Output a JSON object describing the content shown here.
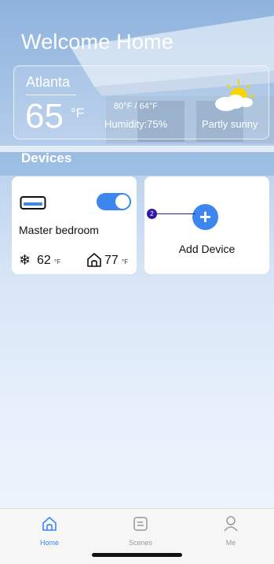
{
  "header": {
    "title": "Welcome Home"
  },
  "weather": {
    "city": "Atlanta",
    "temperature": "65",
    "unit": "°F",
    "high_low": "80°F / 64°F",
    "humidity": "Humidity:75%",
    "condition": "Partly sunny",
    "icon": "partly-sunny-icon"
  },
  "devices": {
    "section_title": "Devices",
    "items": [
      {
        "room": "Master bedroom",
        "icon": "air-conditioner-icon",
        "power_on": true,
        "set_temp": "62",
        "set_unit": "°F",
        "current_temp": "77",
        "current_unit": "°F"
      }
    ],
    "add_label": "Add Device"
  },
  "annotation": {
    "badge": "2"
  },
  "tabbar": {
    "items": [
      {
        "label": "Home",
        "icon": "home-icon",
        "active": true
      },
      {
        "label": "Scenes",
        "icon": "scenes-icon",
        "active": false
      },
      {
        "label": "Me",
        "icon": "profile-icon",
        "active": false
      }
    ]
  },
  "colors": {
    "accent": "#3d86ef",
    "badge": "#2b1aa8"
  }
}
